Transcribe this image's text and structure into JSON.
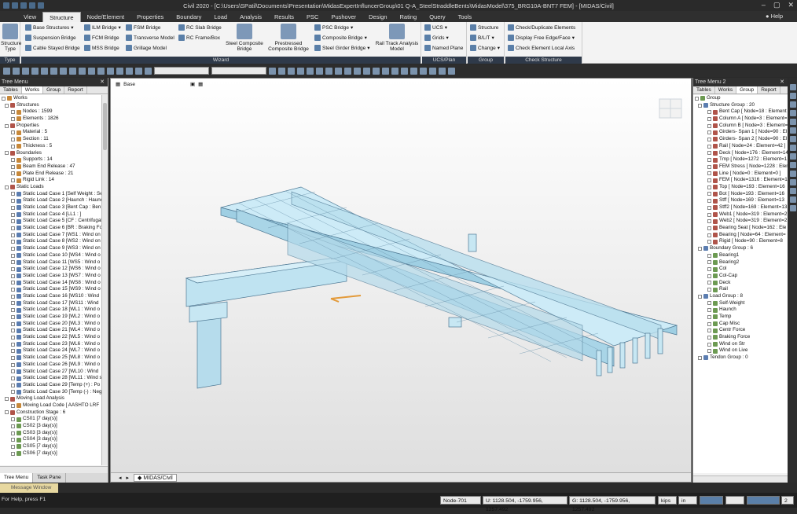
{
  "window": {
    "title": "Civil 2020 - [C:\\Users\\SPatil\\Documents\\Presentation\\MidasExpertInfluncerGroup\\01 Q-A_SteelStraddleBents\\MidasModel\\375_BRG10A-BNT7 FEM] - [MIDAS/Civil]",
    "help": "Help"
  },
  "menu": [
    "View",
    "Structure",
    "Node/Element",
    "Properties",
    "Boundary",
    "Load",
    "Analysis",
    "Results",
    "PSC",
    "Pushover",
    "Design",
    "Rating",
    "Query",
    "Tools"
  ],
  "menu_active": "Structure",
  "ribbon": {
    "type_group": {
      "button": "Structure Type",
      "label": "Type"
    },
    "wizard_group": {
      "label": "Wizard",
      "col1": [
        "Base Structures",
        "Suspension Bridge",
        "Cable Stayed Bridge"
      ],
      "col2": [
        "ILM Bridge",
        "FCM Bridge",
        "MSS Bridge"
      ],
      "col3": [
        "FSM Bridge",
        "Transverse Model",
        "Grillage Model"
      ],
      "col4": [
        "RC Slab Bridge",
        "RC Frame/Box"
      ],
      "big1": "Steel Composite Bridge",
      "big2": "Prestressed Composite Bridge",
      "col5": [
        "PSC Bridge",
        "Composite Bridge",
        "Steel Girder Bridge"
      ],
      "big3": "Rail Track Analysis Model"
    },
    "ucs_group": {
      "label": "UCS/Plan",
      "items": [
        "UCS",
        "Grids",
        "Named Plane"
      ]
    },
    "group_group": {
      "label": "Group",
      "items": [
        "Structure",
        "B/L/T",
        "Change"
      ]
    },
    "check_group": {
      "label": "Check Structure",
      "items": [
        "Check/Duplicate Elements",
        "Display Free Edge/Face",
        "Check Element Local Axis"
      ]
    }
  },
  "left_panel": {
    "title": "Tree Menu",
    "tabs": [
      "Tables",
      "Works",
      "Group",
      "Report"
    ],
    "active_tab": "Works",
    "tree": [
      "Works",
      "Structures",
      "Nodes : 1599",
      "Elements : 1826",
      "Properties",
      "Material : 5",
      "Section : 11",
      "Thickness : 5",
      "Boundaries",
      "Supports : 14",
      "Beam End Release : 47",
      "Plate End Release : 21",
      "Rigid Link : 14",
      "Static Loads",
      "Static Load Case 1 [Self Weight : Se",
      "Static Load Case 2 [Haunch : Haunc",
      "Static Load Case 3 [Bent Cap : Ben",
      "Static Load Case 4 [LL1 : ]",
      "Static Load Case 5 [CF : Centrifugal",
      "Static Load Case 6 [BR : Braking Fo",
      "Static Load Case 7 [WS1 : Wind on",
      "Static Load Case 8 [WS2 : Wind on",
      "Static Load Case 9 [WS3 : Wind on",
      "Static Load Case 10 [WS4 : Wind o",
      "Static Load Case 11 [WS5 : Wind o",
      "Static Load Case 12 [WS6 : Wind o",
      "Static Load Case 13 [WS7 : Wind o",
      "Static Load Case 14 [WS8 : Wind o",
      "Static Load Case 15 [WS9 : Wind o",
      "Static Load Case 16 [WS10 : Wind",
      "Static Load Case 17 [WS11 : Wind",
      "Static Load Case 18 [WL1 : Wind o",
      "Static Load Case 19 [WL2 : Wind o",
      "Static Load Case 20 [WL3 : Wind o",
      "Static Load Case 21 [WL4 : Wind o",
      "Static Load Case 22 [WL5 : Wind o",
      "Static Load Case 23 [WL6 : Wind o",
      "Static Load Case 24 [WL7 : Wind o",
      "Static Load Case 25 [WL8 : Wind o",
      "Static Load Case 26 [WL9 : Wind o",
      "Static Load Case 27 [WL10 : Wind",
      "Static Load Case 28 [WL11 : Wind s",
      "Static Load Case 29 [Temp (+) : Po",
      "Static Load Case 30 [Temp (-) : Neg",
      "Moving Load Analysis",
      "Moving Load Code [ AASHTO LRF",
      "Construction Stage : 6",
      "CS01 [7 day(s)]",
      "CS02 [3 day(s)]",
      "CS03 [3 day(s)]",
      "CS04 [3 day(s)]",
      "CS05 [7 day(s)]",
      "CS06 [7 day(s)]"
    ],
    "bottom_tabs": [
      "Tree Menu",
      "Task Pane"
    ]
  },
  "viewport": {
    "view_label": "Base",
    "tab": "MIDAS/Civil"
  },
  "right_panel": {
    "title": "Tree Menu 2",
    "tabs": [
      "Tables",
      "Works",
      "Group",
      "Report"
    ],
    "active_tab": "Group",
    "tree": [
      "Group",
      "Structure Group : 20",
      "Bent Cap [ Node=18 : Element",
      "Column A [ Node=3 : Element=",
      "Column B [ Node=3 : Element=",
      "Girders- Span 1 [ Node=90 : El",
      "Girders- Span 2 [ Node=90 : El",
      "Rail [ Node=24 : Element=42 ]",
      "Deck [ Node=176 : Element=14",
      "Tmp [ Node=1272 : Element=1",
      "FEM Stress [ Node=1228 : Elem",
      "Line [ Node=0 : Element=0 ]",
      "FEM [ Node=1316 : Element=1",
      "Top [ Node=193 : Element=16",
      "Bot [ Node=193 : Element=16",
      "Stff [ Node=169 : Element=13",
      "Stff2 [ Node=169 : Element=13",
      "Web1 [ Node=319 : Element=2",
      "Web2 [ Node=319 : Element=2",
      "Bearing Seat [ Node=162 : Ele",
      "Bearing [ Node=64 : Element=",
      "Rigid [ Node=90 : Element=8",
      "Boundary Group : 6",
      "Bearing1",
      "Bearing2",
      "Col",
      "Col-Cap",
      "Deck",
      "Rail",
      "Load Group : 8",
      "Self-Weight",
      "Haunch",
      "Temp",
      "Cap Misc",
      "Centr Force",
      "Braking Force",
      "Wind on Str",
      "Wind on Live",
      "Tendon Group : 0"
    ]
  },
  "message_window": "Message Window",
  "status": {
    "help_text": "For Help, press F1",
    "node": "Node-701",
    "u": "U: 1128.504, -1759.956, 1257.492",
    "g": "G: 1128.504, -1759.956, 1257.492",
    "force_unit": "kips",
    "length_unit": "in",
    "page": "2"
  }
}
